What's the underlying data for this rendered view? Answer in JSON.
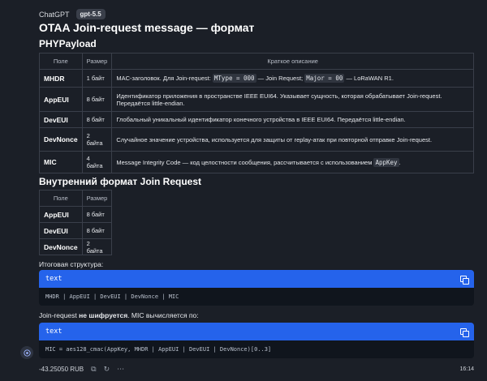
{
  "header": {
    "app_name": "ChatGPT",
    "model_badge": "gpt-5.5"
  },
  "title": "OTAA Join-request message — формат",
  "section_phy": "PHYPayload",
  "phy_table": {
    "headers": [
      "Поле",
      "Размер",
      "Краткое описание"
    ],
    "rows": [
      {
        "field": "MHDR",
        "size": "1 байт",
        "desc_parts": [
          "MAC-заголовок. Для Join-request: ",
          "MType = 000",
          " — Join Request; ",
          "Major = 00",
          " — LoRaWAN R1."
        ]
      },
      {
        "field": "AppEUI",
        "size": "8 байт",
        "desc": "Идентификатор приложения в пространстве IEEE EUI64. Указывает сущность, которая обрабатывает Join-request. Передаётся little-endian."
      },
      {
        "field": "DevEUI",
        "size": "8 байт",
        "desc": "Глобальный уникальный идентификатор конечного устройства в IEEE EUI64. Передаётся little-endian."
      },
      {
        "field": "DevNonce",
        "size": "2 байта",
        "desc": "Случайное значение устройства, используется для защиты от replay-атак при повторной отправке Join-request."
      },
      {
        "field": "MIC",
        "size": "4 байта",
        "desc_parts": [
          "Message Integrity Code — код целостности сообщения, рассчитывается с использованием ",
          "AppKey",
          "."
        ]
      }
    ]
  },
  "section_internal": "Внутренний формат Join Request",
  "internal_table": {
    "headers": [
      "Поле",
      "Размер"
    ],
    "rows": [
      {
        "field": "AppEUI",
        "size": "8 байт"
      },
      {
        "field": "DevEUI",
        "size": "8 байт"
      },
      {
        "field": "DevNonce",
        "size": "2 байта"
      }
    ]
  },
  "final_structure_label": "Итоговая структура:",
  "code1": {
    "lang": "text",
    "content": "MHDR | AppEUI | DevEUI | DevNonce | MIC"
  },
  "mic_text": {
    "prefix": "Join-request ",
    "bold": "не шифруется",
    "suffix": ". MIC вычисляется по:"
  },
  "code2": {
    "lang": "text",
    "content": "MIC = aes128_cmac(AppKey, MHDR | AppEUI | DevEUI | DevNonce)[0..3]"
  },
  "footer": {
    "cost": "-43.25050 RUB",
    "time": "16:14"
  },
  "icons": [
    "copy-icon",
    "avatar-icon",
    "copy-message-icon",
    "regenerate-icon",
    "more-icon"
  ]
}
